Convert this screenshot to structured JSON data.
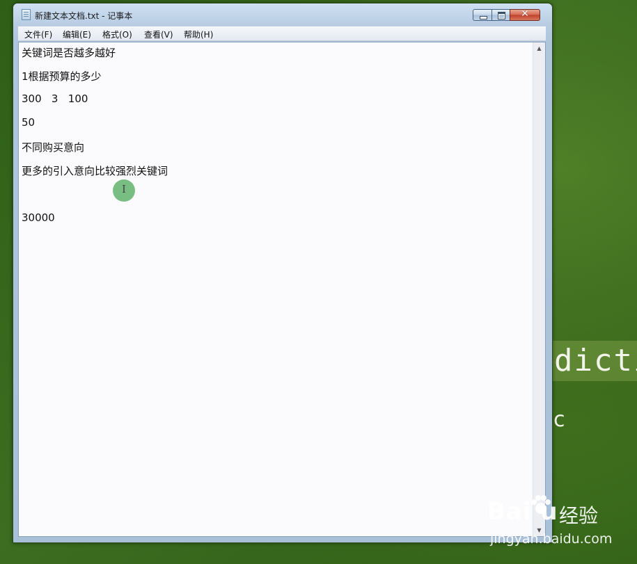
{
  "window": {
    "title": "新建文本文档.txt - 记事本",
    "controls": {
      "minimize": "minimize",
      "maximize": "maximize",
      "close": "close"
    }
  },
  "menubar": {
    "items": [
      "文件(F)",
      "编辑(E)",
      "格式(O)",
      "查看(V)",
      "帮助(H)"
    ]
  },
  "document": {
    "lines": [
      "关键词是否越多越好",
      "1根据预算的多少",
      "300   3   100",
      "50",
      "不同购买意向",
      "更多的引入意向比较强烈关键词",
      "",
      "30000"
    ]
  },
  "cursor": {
    "glyph": "I"
  },
  "background": {
    "text": "dicti",
    "glyph": "c"
  },
  "watermark": {
    "logo": "Bai  u",
    "cn": "经验",
    "url": "jingyan.baidu.com"
  }
}
